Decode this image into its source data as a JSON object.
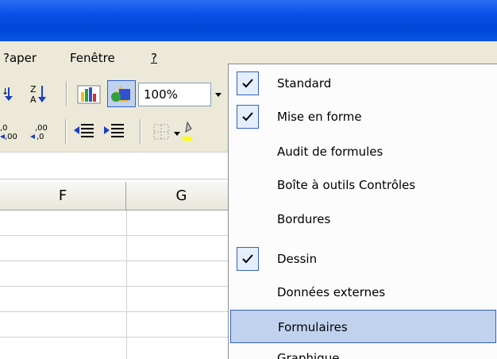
{
  "menubar": {
    "items": [
      {
        "label": "?aper",
        "underline_char": "P"
      },
      {
        "label": "Fenêtre",
        "underline_char": "n"
      },
      {
        "label": "?"
      }
    ]
  },
  "toolbar": {
    "zoom": "100%"
  },
  "columns": [
    "F",
    "G"
  ],
  "toolbars_menu": {
    "items": [
      {
        "label": "Standard",
        "checked": true
      },
      {
        "label": "Mise en forme",
        "checked": true
      },
      {
        "label": "Audit de formules",
        "checked": false
      },
      {
        "label": "Boîte à outils Contrôles",
        "checked": false
      },
      {
        "label": "Bordures",
        "checked": false
      },
      {
        "label": "Dessin",
        "checked": true
      },
      {
        "label": "Données externes",
        "checked": false
      },
      {
        "label": "Formulaires",
        "checked": false,
        "highlighted": true
      },
      {
        "label": "Graphique",
        "checked": false
      }
    ]
  },
  "colors": {
    "titlebar": "#0a50e8",
    "menu_highlight": "#c1d2ee",
    "menu_border": "#3160c8",
    "toolbar_bg": "#ece9d8"
  }
}
